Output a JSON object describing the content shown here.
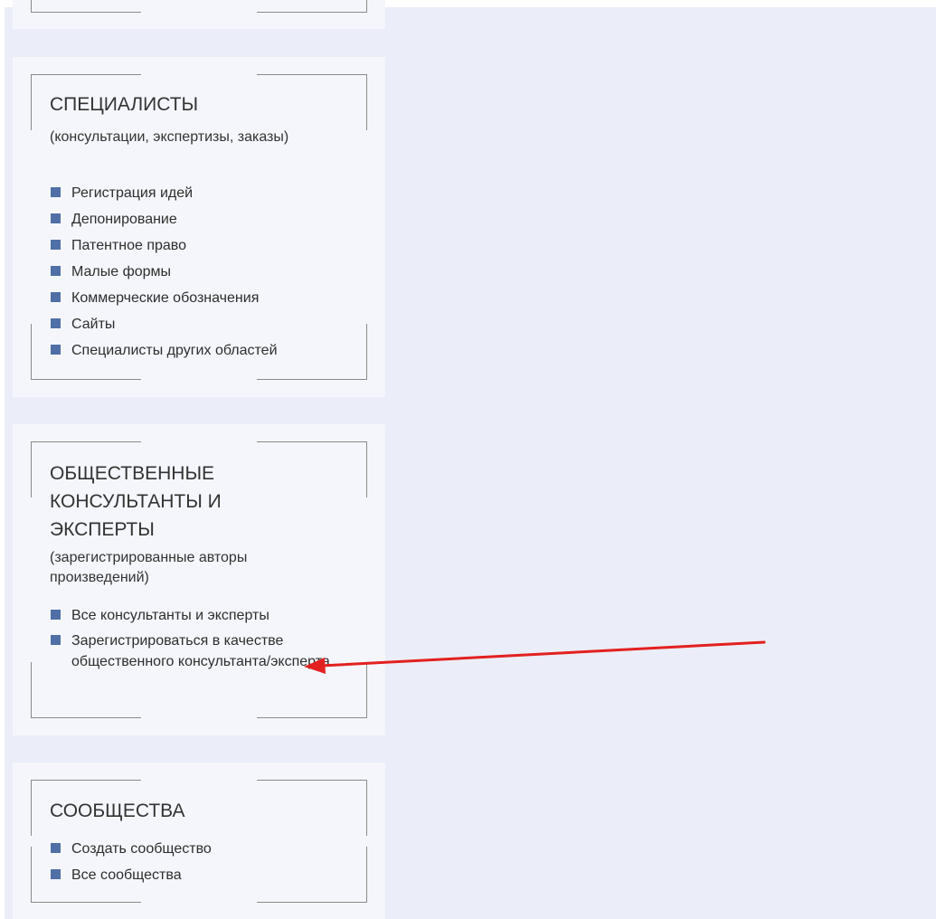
{
  "sections": {
    "specialists": {
      "title": "СПЕЦИАЛИСТЫ",
      "subtitle": "(консультации, экспертизы, заказы)",
      "items": [
        "Регистрация идей",
        "Депонирование",
        "Патентное право",
        "Малые формы",
        "Коммерческие обозначения",
        "Сайты",
        "Специалисты других областей"
      ]
    },
    "public_consultants": {
      "title": "ОБЩЕСТВЕННЫЕ КОНСУЛЬТАНТЫ И ЭКСПЕРТЫ",
      "subtitle": "(зарегистрированные авторы произведений)",
      "items": [
        "Все консультанты и эксперты",
        "Зарегистрироваться в качестве общественного консультанта/эксперта"
      ]
    },
    "communities": {
      "title": "СООБЩЕСТВА",
      "items": [
        "Создать сообщество",
        "Все сообщества"
      ]
    }
  },
  "colors": {
    "page_background": "#ebeef8",
    "card_background": "#f4f6fb",
    "bullet": "#4f6fa6",
    "frame_line": "#8a8a8a",
    "annotation_arrow": "#e32020"
  },
  "icons": {
    "bullet": "square-bullet-icon",
    "annotation": "red-arrow-icon"
  }
}
